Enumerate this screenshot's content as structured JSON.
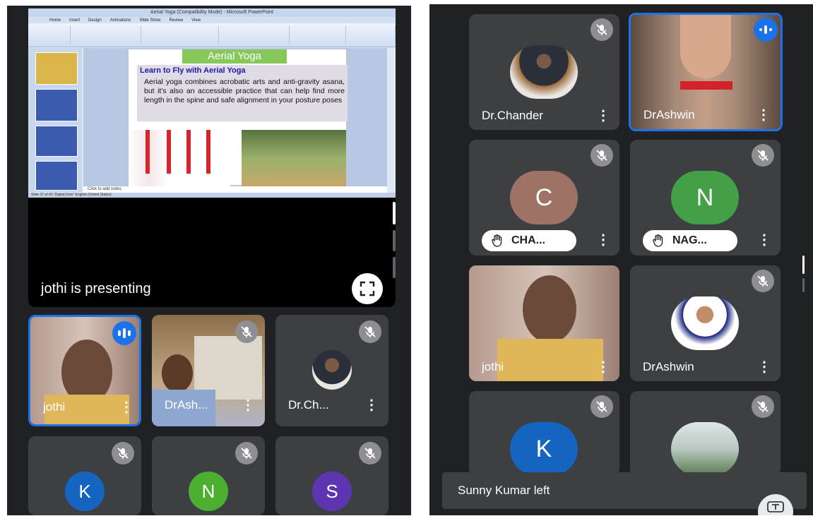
{
  "presentation": {
    "app_title": "Aerial Yoga (Compatibility Mode) - Microsoft PowerPoint",
    "ribbon_tabs": [
      "Home",
      "Insert",
      "Design",
      "Animations",
      "Slide Show",
      "Review",
      "View"
    ],
    "slide_title": "Aerial Yoga",
    "slide_subtitle": "Learn to Fly with Aerial Yoga",
    "slide_body": "Aerial yoga combines acrobatic arts and anti-gravity asana, but it's also an accessible practice that can help find more length in the spine and safe alignment in your posture poses",
    "notes_placeholder": "Click to add notes",
    "status_bar": "Slide 37 of 43   \"Digital Dots\"   English (United States)",
    "presenting_label": "jothi is presenting"
  },
  "left_tiles": [
    {
      "name": "jothi"
    },
    {
      "name": "DrAsh..."
    },
    {
      "name": "Dr.Ch..."
    },
    {
      "initial": "K"
    },
    {
      "initial": "N"
    },
    {
      "initial": "S"
    }
  ],
  "right_tiles": [
    {
      "name": "Dr.Chander"
    },
    {
      "name": "DrAshwin"
    },
    {
      "initial": "C",
      "name": "CHA..."
    },
    {
      "initial": "N",
      "name": "NAG..."
    },
    {
      "name": "jothi"
    },
    {
      "name": "DrAshwin"
    },
    {
      "initial": "K"
    },
    {
      "name": ""
    }
  ],
  "toast": "Sunny Kumar left",
  "colors": {
    "background": "#202124",
    "tile": "#3c4043",
    "speaking_accent": "#1a73e8",
    "avatar_k": "#1565c0",
    "avatar_n": "#4caf30",
    "avatar_s": "#5e35b1",
    "avatar_c": "#9e7366",
    "avatar_n_right": "#43a047"
  },
  "icons": [
    "mic-off-icon",
    "speaking-indicator-icon",
    "more-vert-icon",
    "raised-hand-icon",
    "fullscreen-icon",
    "captions-icon"
  ]
}
